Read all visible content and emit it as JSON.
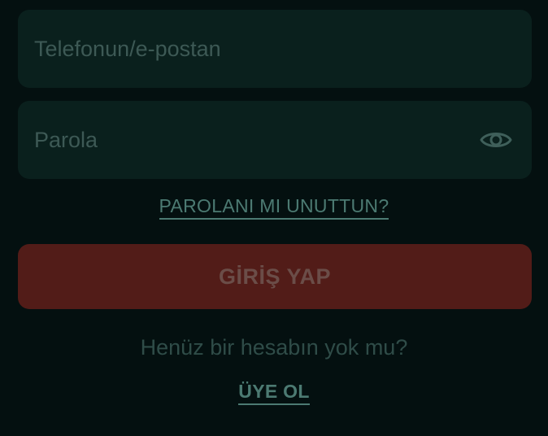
{
  "login_form": {
    "phone_field": {
      "placeholder": "Telefonun/e-postan",
      "value": ""
    },
    "password_field": {
      "placeholder": "Parola",
      "value": "",
      "toggle_icon": "eye-icon"
    },
    "forgot_password_label": "PAROLANI MI UNUTTUN?",
    "login_button_label": "GİRİŞ YAP",
    "no_account_text": "Henüz bir hesabın yok mu?",
    "signup_label": "ÜYE OL"
  },
  "colors": {
    "background": "#041010",
    "field_background": "#0a201d",
    "login_button_background": "#521c18",
    "link_color": "#4c7a72"
  }
}
